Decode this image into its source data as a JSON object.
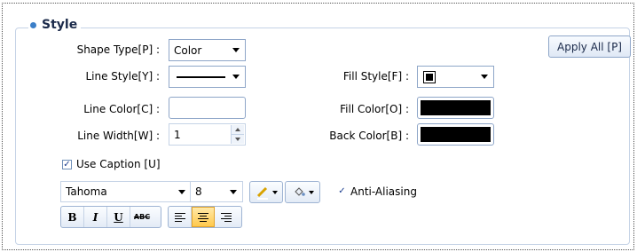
{
  "group": {
    "title": "Style"
  },
  "apply_all_label": "Apply All [P]",
  "shape_type": {
    "label": "Shape Type[P] :",
    "value": "Color"
  },
  "line_style": {
    "label": "Line Style[Y] :"
  },
  "line_color": {
    "label": "Line Color[C] :",
    "value": ""
  },
  "line_width": {
    "label": "Line Width[W] :",
    "value": "1"
  },
  "fill_style": {
    "label": "Fill Style[F] :"
  },
  "fill_color": {
    "label": "Fill Color[O] :",
    "color": "#000000"
  },
  "back_color": {
    "label": "Back Color[B] :",
    "color": "#000000"
  },
  "use_caption": {
    "label": "Use Caption [U]",
    "checked": true
  },
  "font": {
    "family": "Tahoma",
    "size": "8"
  },
  "anti_aliasing": {
    "label": "Anti-Aliasing",
    "checked": true
  },
  "format_buttons": {
    "bold": "B",
    "italic": "I",
    "underline": "U",
    "strike": "ABC"
  },
  "colors": {
    "accent": "#3c7fc8",
    "border": "#8ea6c8",
    "active": "#ffc94d"
  }
}
